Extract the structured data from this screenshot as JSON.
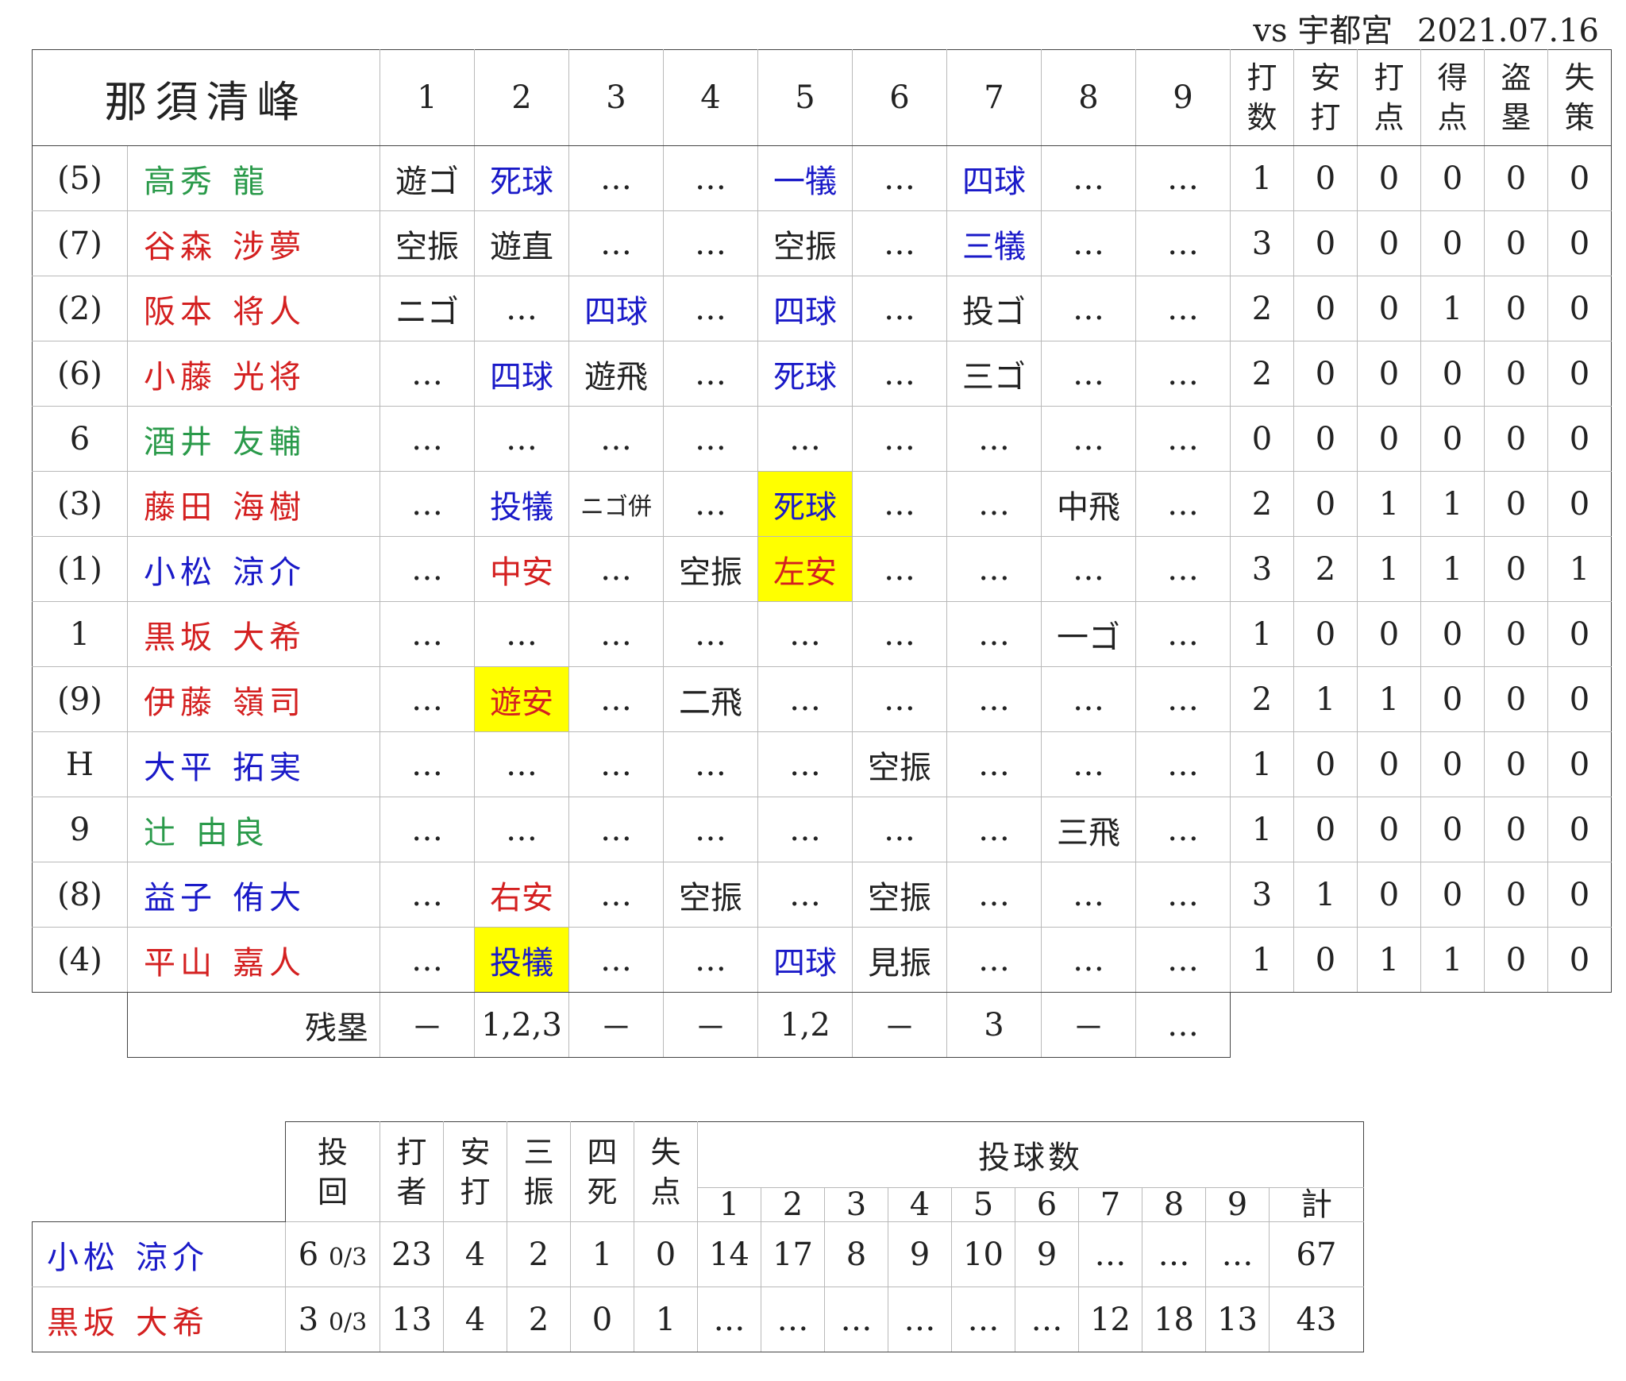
{
  "header": {
    "opponent": "vs 宇都宮",
    "date": "2021.07.16"
  },
  "team": "那須清峰",
  "innings": [
    "1",
    "2",
    "3",
    "4",
    "5",
    "6",
    "7",
    "8",
    "9"
  ],
  "stat_headers": [
    [
      "打",
      "数"
    ],
    [
      "安",
      "打"
    ],
    [
      "打",
      "点"
    ],
    [
      "得",
      "点"
    ],
    [
      "盗",
      "塁"
    ],
    [
      "失",
      "策"
    ]
  ],
  "batters": [
    {
      "pos": "(5)",
      "family": "高秀",
      "given": "龍",
      "color": "#2a9a4a",
      "results": [
        {
          "t": "遊ゴ",
          "c": "black"
        },
        {
          "t": "死球",
          "c": "blue"
        },
        {
          "t": "…",
          "c": "black"
        },
        {
          "t": "…",
          "c": "black"
        },
        {
          "t": "一犠",
          "c": "blue"
        },
        {
          "t": "…",
          "c": "black"
        },
        {
          "t": "四球",
          "c": "blue"
        },
        {
          "t": "…",
          "c": "black"
        },
        {
          "t": "…",
          "c": "black"
        }
      ],
      "stats": [
        "1",
        "0",
        "0",
        "0",
        "0",
        "0"
      ]
    },
    {
      "pos": "(7)",
      "family": "谷森",
      "given": "涉夢",
      "color": "#d42020",
      "results": [
        {
          "t": "空振",
          "c": "black"
        },
        {
          "t": "遊直",
          "c": "black"
        },
        {
          "t": "…",
          "c": "black"
        },
        {
          "t": "…",
          "c": "black"
        },
        {
          "t": "空振",
          "c": "black"
        },
        {
          "t": "…",
          "c": "black"
        },
        {
          "t": "三犠",
          "c": "blue"
        },
        {
          "t": "…",
          "c": "black"
        },
        {
          "t": "…",
          "c": "black"
        }
      ],
      "stats": [
        "3",
        "0",
        "0",
        "0",
        "0",
        "0"
      ]
    },
    {
      "pos": "(2)",
      "family": "阪本",
      "given": "将人",
      "color": "#d42020",
      "results": [
        {
          "t": "ニゴ",
          "c": "black"
        },
        {
          "t": "…",
          "c": "black"
        },
        {
          "t": "四球",
          "c": "blue"
        },
        {
          "t": "…",
          "c": "black"
        },
        {
          "t": "四球",
          "c": "blue"
        },
        {
          "t": "…",
          "c": "black"
        },
        {
          "t": "投ゴ",
          "c": "black"
        },
        {
          "t": "…",
          "c": "black"
        },
        {
          "t": "…",
          "c": "black"
        }
      ],
      "stats": [
        "2",
        "0",
        "0",
        "1",
        "0",
        "0"
      ]
    },
    {
      "pos": "(6)",
      "family": "小藤",
      "given": "光将",
      "color": "#d42020",
      "results": [
        {
          "t": "…",
          "c": "black"
        },
        {
          "t": "四球",
          "c": "blue"
        },
        {
          "t": "遊飛",
          "c": "black"
        },
        {
          "t": "…",
          "c": "black"
        },
        {
          "t": "死球",
          "c": "blue"
        },
        {
          "t": "…",
          "c": "black"
        },
        {
          "t": "三ゴ",
          "c": "black"
        },
        {
          "t": "…",
          "c": "black"
        },
        {
          "t": "…",
          "c": "black"
        }
      ],
      "stats": [
        "2",
        "0",
        "0",
        "0",
        "0",
        "0"
      ]
    },
    {
      "pos": "6",
      "family": "酒井",
      "given": "友輔",
      "color": "#2a9a4a",
      "results": [
        {
          "t": "…",
          "c": "black"
        },
        {
          "t": "…",
          "c": "black"
        },
        {
          "t": "…",
          "c": "black"
        },
        {
          "t": "…",
          "c": "black"
        },
        {
          "t": "…",
          "c": "black"
        },
        {
          "t": "…",
          "c": "black"
        },
        {
          "t": "…",
          "c": "black"
        },
        {
          "t": "…",
          "c": "black"
        },
        {
          "t": "…",
          "c": "black"
        }
      ],
      "stats": [
        "0",
        "0",
        "0",
        "0",
        "0",
        "0"
      ]
    },
    {
      "pos": "(3)",
      "family": "藤田",
      "given": "海樹",
      "color": "#d42020",
      "results": [
        {
          "t": "…",
          "c": "black"
        },
        {
          "t": "投犠",
          "c": "blue"
        },
        {
          "t": "ニゴ併",
          "c": "black",
          "small": true
        },
        {
          "t": "…",
          "c": "black"
        },
        {
          "t": "死球",
          "c": "blue",
          "hl": true
        },
        {
          "t": "…",
          "c": "black"
        },
        {
          "t": "…",
          "c": "black"
        },
        {
          "t": "中飛",
          "c": "black"
        },
        {
          "t": "…",
          "c": "black"
        }
      ],
      "stats": [
        "2",
        "0",
        "1",
        "1",
        "0",
        "0"
      ]
    },
    {
      "pos": "(1)",
      "family": "小松",
      "given": "涼介",
      "color": "#1a1ac8",
      "results": [
        {
          "t": "…",
          "c": "black"
        },
        {
          "t": "中安",
          "c": "red"
        },
        {
          "t": "…",
          "c": "black"
        },
        {
          "t": "空振",
          "c": "black"
        },
        {
          "t": "左安",
          "c": "red",
          "hl": true
        },
        {
          "t": "…",
          "c": "black"
        },
        {
          "t": "…",
          "c": "black"
        },
        {
          "t": "…",
          "c": "black"
        },
        {
          "t": "…",
          "c": "black"
        }
      ],
      "stats": [
        "3",
        "2",
        "1",
        "1",
        "0",
        "1"
      ]
    },
    {
      "pos": "1",
      "family": "黒坂",
      "given": "大希",
      "color": "#d42020",
      "results": [
        {
          "t": "…",
          "c": "black"
        },
        {
          "t": "…",
          "c": "black"
        },
        {
          "t": "…",
          "c": "black"
        },
        {
          "t": "…",
          "c": "black"
        },
        {
          "t": "…",
          "c": "black"
        },
        {
          "t": "…",
          "c": "black"
        },
        {
          "t": "…",
          "c": "black"
        },
        {
          "t": "一ゴ",
          "c": "black"
        },
        {
          "t": "…",
          "c": "black"
        }
      ],
      "stats": [
        "1",
        "0",
        "0",
        "0",
        "0",
        "0"
      ]
    },
    {
      "pos": "(9)",
      "family": "伊藤",
      "given": "嶺司",
      "color": "#d42020",
      "results": [
        {
          "t": "…",
          "c": "black"
        },
        {
          "t": "遊安",
          "c": "red",
          "hl": true
        },
        {
          "t": "…",
          "c": "black"
        },
        {
          "t": "二飛",
          "c": "black"
        },
        {
          "t": "…",
          "c": "black"
        },
        {
          "t": "…",
          "c": "black"
        },
        {
          "t": "…",
          "c": "black"
        },
        {
          "t": "…",
          "c": "black"
        },
        {
          "t": "…",
          "c": "black"
        }
      ],
      "stats": [
        "2",
        "1",
        "1",
        "0",
        "0",
        "0"
      ]
    },
    {
      "pos": "H",
      "family": "大平",
      "given": "拓実",
      "color": "#1a1ac8",
      "results": [
        {
          "t": "…",
          "c": "black"
        },
        {
          "t": "…",
          "c": "black"
        },
        {
          "t": "…",
          "c": "black"
        },
        {
          "t": "…",
          "c": "black"
        },
        {
          "t": "…",
          "c": "black"
        },
        {
          "t": "空振",
          "c": "black"
        },
        {
          "t": "…",
          "c": "black"
        },
        {
          "t": "…",
          "c": "black"
        },
        {
          "t": "…",
          "c": "black"
        }
      ],
      "stats": [
        "1",
        "0",
        "0",
        "0",
        "0",
        "0"
      ]
    },
    {
      "pos": "9",
      "family": "辻",
      "given": "由良",
      "color": "#2a9a4a",
      "results": [
        {
          "t": "…",
          "c": "black"
        },
        {
          "t": "…",
          "c": "black"
        },
        {
          "t": "…",
          "c": "black"
        },
        {
          "t": "…",
          "c": "black"
        },
        {
          "t": "…",
          "c": "black"
        },
        {
          "t": "…",
          "c": "black"
        },
        {
          "t": "…",
          "c": "black"
        },
        {
          "t": "三飛",
          "c": "black"
        },
        {
          "t": "…",
          "c": "black"
        }
      ],
      "stats": [
        "1",
        "0",
        "0",
        "0",
        "0",
        "0"
      ]
    },
    {
      "pos": "(8)",
      "family": "益子",
      "given": "侑大",
      "color": "#1a1ac8",
      "results": [
        {
          "t": "…",
          "c": "black"
        },
        {
          "t": "右安",
          "c": "red"
        },
        {
          "t": "…",
          "c": "black"
        },
        {
          "t": "空振",
          "c": "black"
        },
        {
          "t": "…",
          "c": "black"
        },
        {
          "t": "空振",
          "c": "black"
        },
        {
          "t": "…",
          "c": "black"
        },
        {
          "t": "…",
          "c": "black"
        },
        {
          "t": "…",
          "c": "black"
        }
      ],
      "stats": [
        "3",
        "1",
        "0",
        "0",
        "0",
        "0"
      ]
    },
    {
      "pos": "(4)",
      "family": "平山",
      "given": "嘉人",
      "color": "#d42020",
      "results": [
        {
          "t": "…",
          "c": "black"
        },
        {
          "t": "投犠",
          "c": "blue",
          "hl": true
        },
        {
          "t": "…",
          "c": "black"
        },
        {
          "t": "…",
          "c": "black"
        },
        {
          "t": "四球",
          "c": "blue"
        },
        {
          "t": "見振",
          "c": "black"
        },
        {
          "t": "…",
          "c": "black"
        },
        {
          "t": "…",
          "c": "black"
        },
        {
          "t": "…",
          "c": "black"
        }
      ],
      "stats": [
        "1",
        "0",
        "1",
        "1",
        "0",
        "0"
      ]
    }
  ],
  "left_on_base": {
    "label": "残塁",
    "values": [
      "－",
      "1,2,3",
      "－",
      "－",
      "1,2",
      "－",
      "3",
      "－",
      "…"
    ]
  },
  "pitching": {
    "headers": [
      [
        "投",
        "回"
      ],
      [
        "打",
        "者"
      ],
      [
        "安",
        "打"
      ],
      [
        "三",
        "振"
      ],
      [
        "四",
        "死"
      ],
      [
        "失",
        "点"
      ]
    ],
    "pitch_count_label": "投球数",
    "pitch_innings": [
      "1",
      "2",
      "3",
      "4",
      "5",
      "6",
      "7",
      "8",
      "9",
      "計"
    ],
    "pitchers": [
      {
        "family": "小松",
        "given": "涼介",
        "color": "#1a1ac8",
        "ip_whole": "6",
        "ip_frac": "0/3",
        "stats": [
          "23",
          "4",
          "2",
          "1",
          "0"
        ],
        "pitches": [
          "14",
          "17",
          "8",
          "9",
          "10",
          "9",
          "…",
          "…",
          "…",
          "67"
        ]
      },
      {
        "family": "黒坂",
        "given": "大希",
        "color": "#d42020",
        "ip_whole": "3",
        "ip_frac": "0/3",
        "stats": [
          "13",
          "4",
          "2",
          "0",
          "1"
        ],
        "pitches": [
          "…",
          "…",
          "…",
          "…",
          "…",
          "…",
          "12",
          "18",
          "13",
          "43"
        ]
      }
    ]
  }
}
